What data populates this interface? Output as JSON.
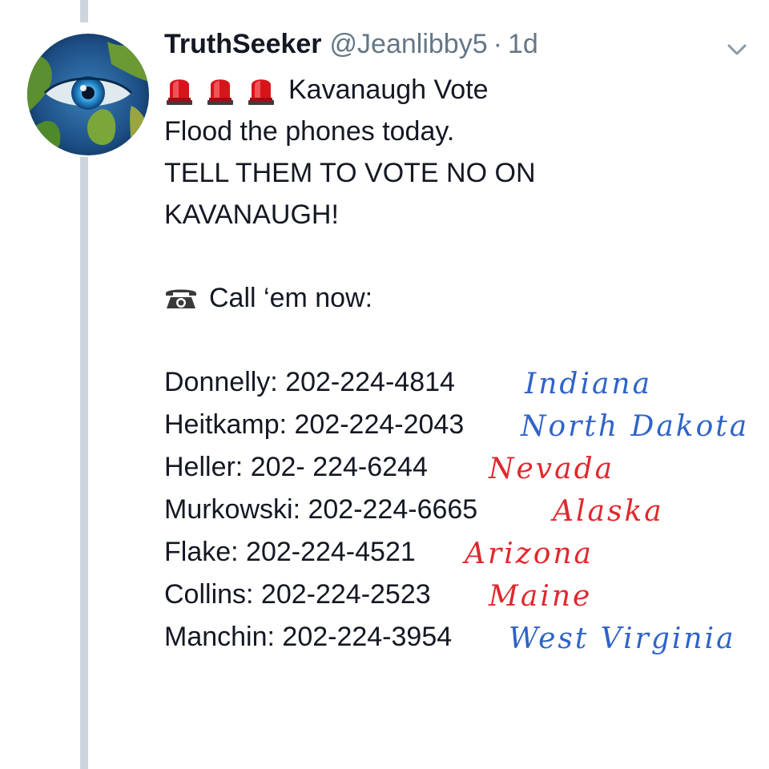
{
  "tweet": {
    "author": {
      "display_name": "TruthSeeker",
      "handle": "@Jeanlibby5",
      "separator": "·",
      "timestamp": "1d",
      "avatar_icon": "earth-eye-avatar"
    },
    "menu_icon": "chevron-down-icon",
    "title_line": {
      "icons": [
        "siren-icon",
        "siren-icon",
        "siren-icon"
      ],
      "text": "Kavanaugh Vote"
    },
    "lines": [
      "Flood the phones today.",
      "TELL THEM TO VOTE NO ON",
      "KAVANAUGH!"
    ],
    "call_line": {
      "icon": "telephone-icon",
      "text": "Call ‘em now:"
    },
    "contacts": [
      {
        "text": "Donnelly: 202-224-4814",
        "state": "Indiana",
        "state_color": "#2f63c8"
      },
      {
        "text": "Heitkamp: 202-224-2043",
        "state": "North Dakota",
        "state_color": "#2f63c8"
      },
      {
        "text": "Heller: 202- 224-6244",
        "state": "Nevada",
        "state_color": "#e0282e"
      },
      {
        "text": "Murkowski: 202-224-6665",
        "state": "Alaska",
        "state_color": "#e0282e"
      },
      {
        "text": "Flake: 202-224-4521",
        "state": "Arizona",
        "state_color": "#e0282e"
      },
      {
        "text": "Collins: 202-224-2523",
        "state": "Maine",
        "state_color": "#e0282e"
      },
      {
        "text": "Manchin: 202-224-3954",
        "state": "West Virginia",
        "state_color": "#2f63c8"
      }
    ]
  },
  "colors": {
    "text": "#141823",
    "muted": "#657786",
    "thread_line": "#ccd6dd",
    "handwriting_blue": "#2f63c8",
    "handwriting_red": "#e0282e"
  }
}
